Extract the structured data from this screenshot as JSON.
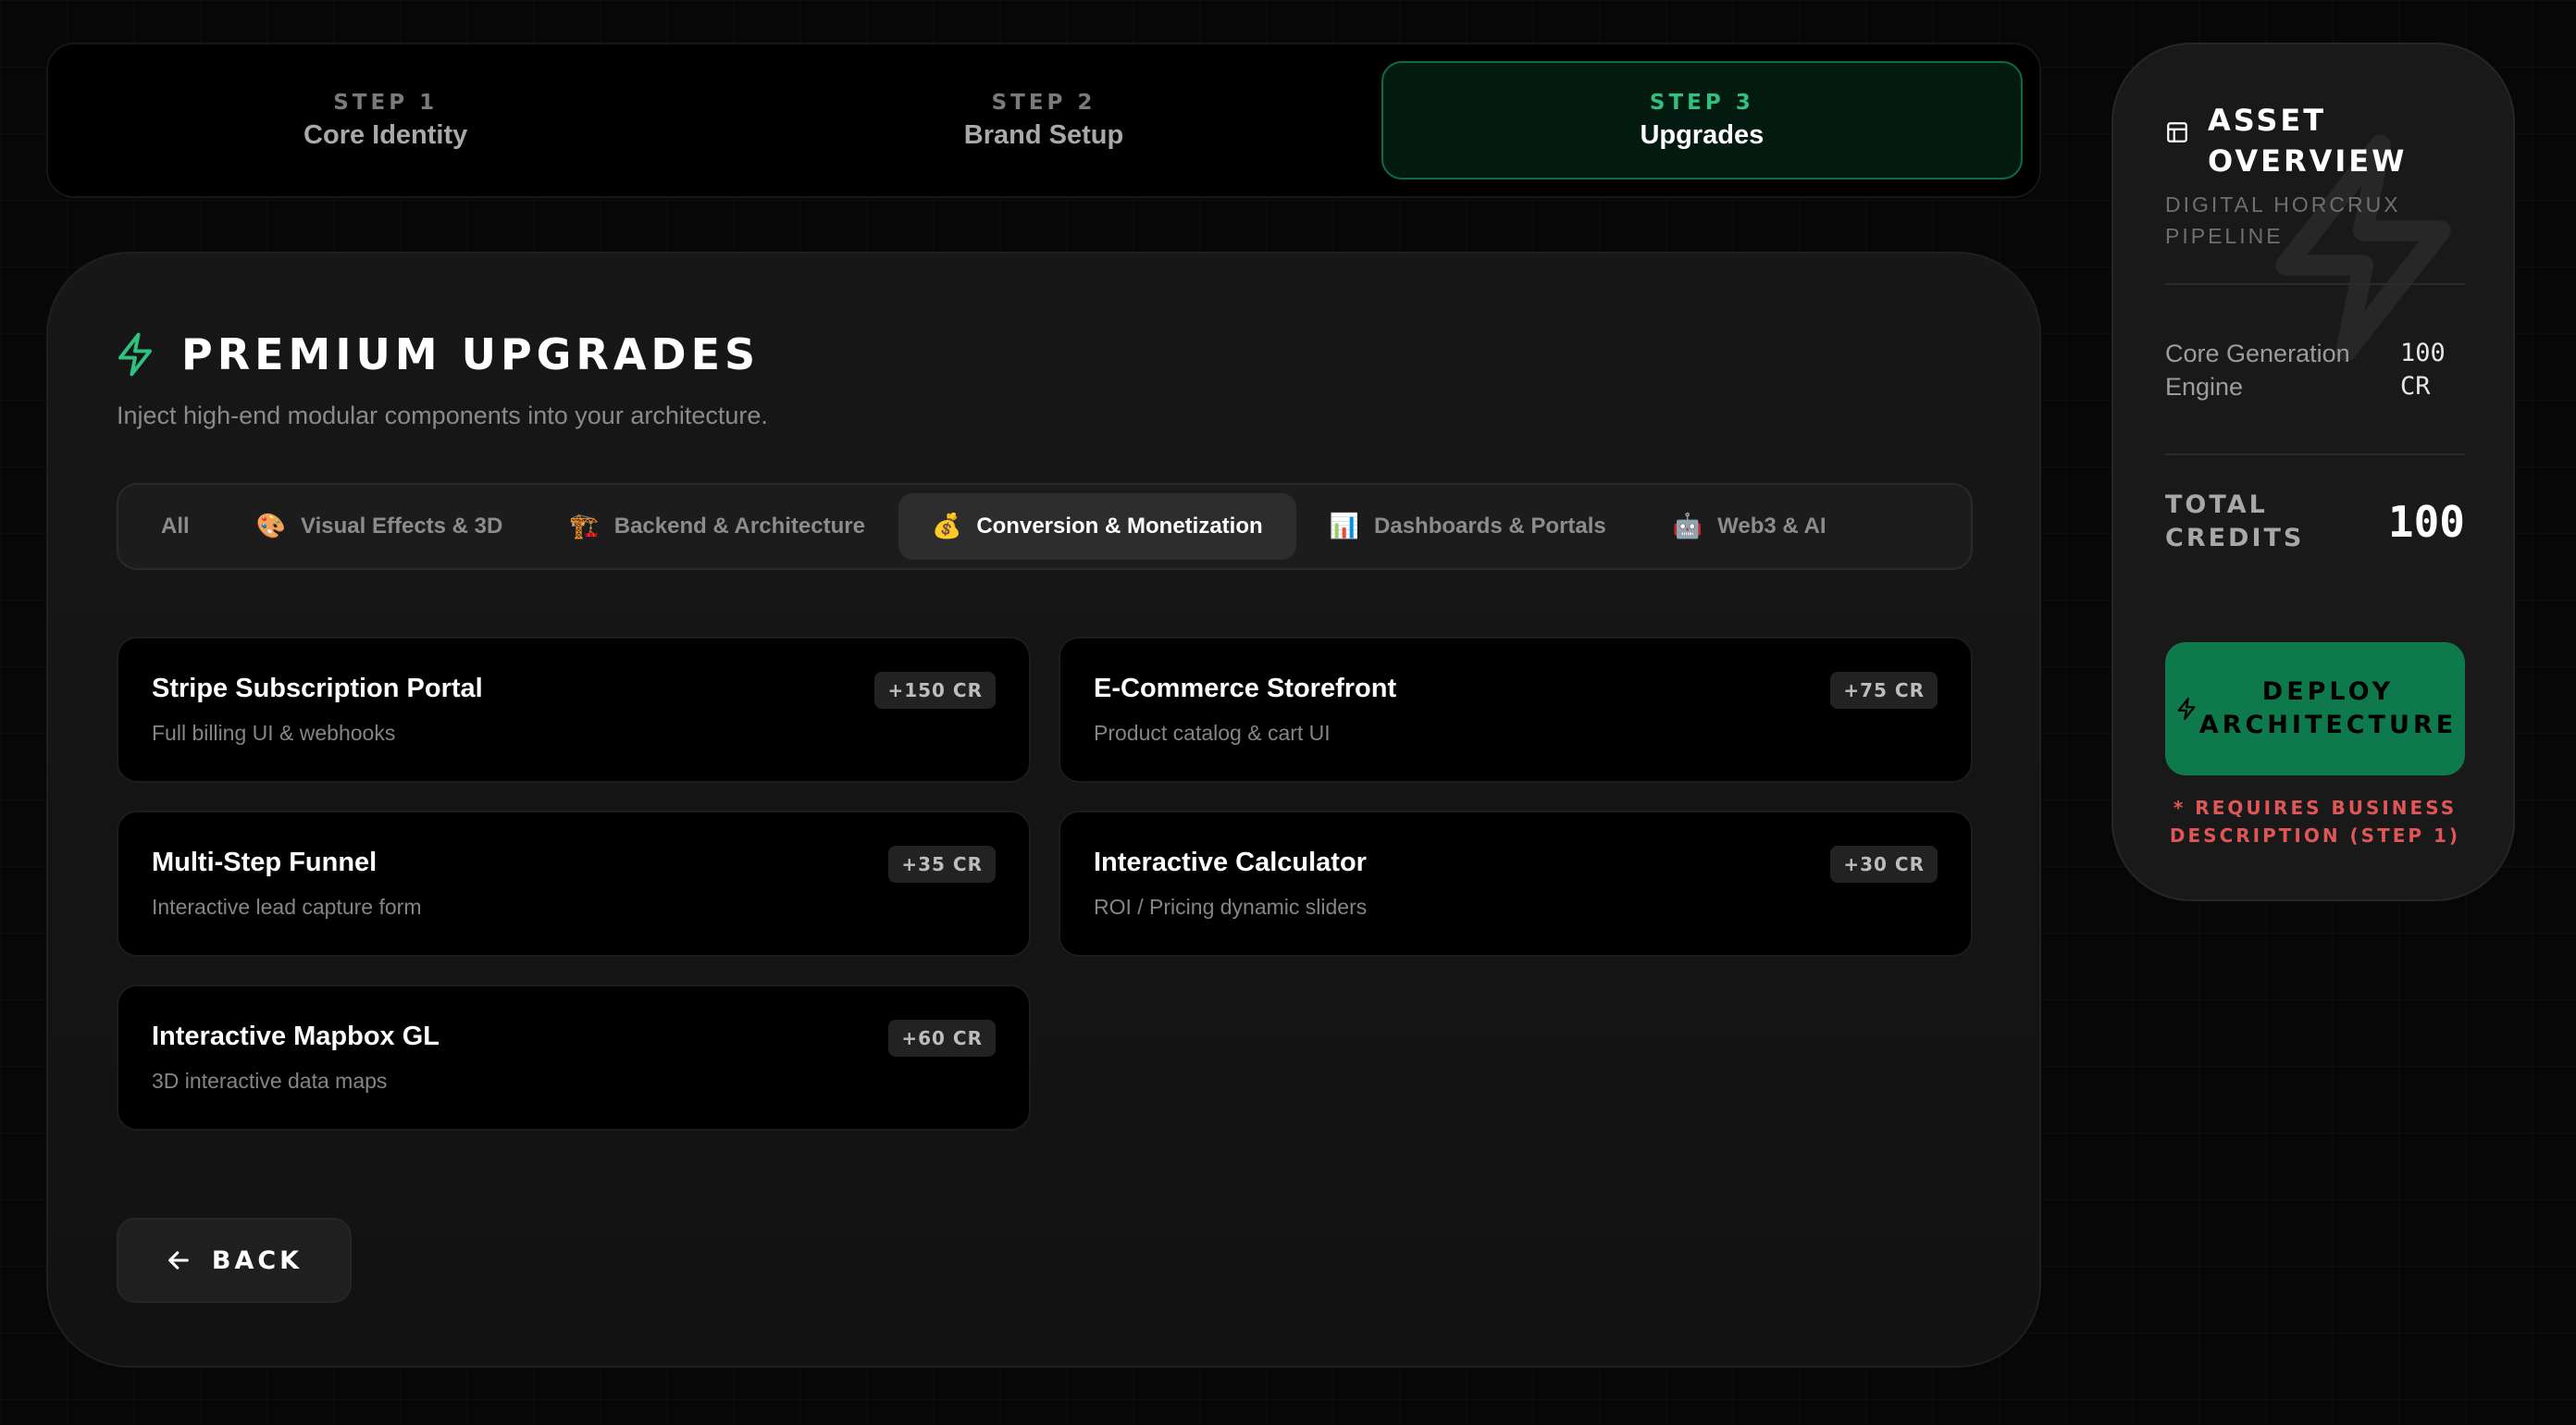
{
  "stepper": {
    "steps": [
      {
        "num": "STEP 1",
        "name": "Core Identity"
      },
      {
        "num": "STEP 2",
        "name": "Brand Setup"
      },
      {
        "num": "STEP 3",
        "name": "Upgrades"
      }
    ],
    "active_index": 2
  },
  "main": {
    "title": "PREMIUM UPGRADES",
    "subtitle": "Inject high-end modular components into your architecture.",
    "tabs": [
      {
        "label": "All",
        "emoji": ""
      },
      {
        "label": "Visual Effects & 3D",
        "emoji": "🎨"
      },
      {
        "label": "Backend & Architecture",
        "emoji": "🏗️"
      },
      {
        "label": "Conversion & Monetization",
        "emoji": "💰"
      },
      {
        "label": "Dashboards & Portals",
        "emoji": "📊"
      },
      {
        "label": "Web3 & AI",
        "emoji": "🤖"
      }
    ],
    "active_tab": 3,
    "items": [
      {
        "title": "Stripe Subscription Portal",
        "desc": "Full billing UI & webhooks",
        "badge": "+150 CR"
      },
      {
        "title": "E-Commerce Storefront",
        "desc": "Product catalog & cart UI",
        "badge": "+75 CR"
      },
      {
        "title": "Multi-Step Funnel",
        "desc": "Interactive lead capture form",
        "badge": "+35 CR"
      },
      {
        "title": "Interactive Calculator",
        "desc": "ROI / Pricing dynamic sliders",
        "badge": "+30 CR"
      },
      {
        "title": "Interactive Mapbox GL",
        "desc": "3D interactive data maps",
        "badge": "+60 CR"
      }
    ],
    "back_label": "BACK"
  },
  "sidebar": {
    "title_line1": "ASSET",
    "title_line2": "OVERVIEW",
    "subtitle_line1": "DIGITAL HORCRUX",
    "subtitle_line2": "PIPELINE",
    "line_item": {
      "label": "Core Generation Engine",
      "value": "100 CR"
    },
    "total_label_line1": "TOTAL",
    "total_label_line2": "CREDITS",
    "total_value": "100",
    "deploy_label": "DEPLOY\nARCHITECTURE",
    "warning": "* REQUIRES BUSINESS DESCRIPTION (STEP 1)"
  },
  "colors": {
    "accent": "#2fc27f",
    "deploy_bg": "#0e7a4c",
    "warning": "#e05656",
    "background": "#070707"
  }
}
